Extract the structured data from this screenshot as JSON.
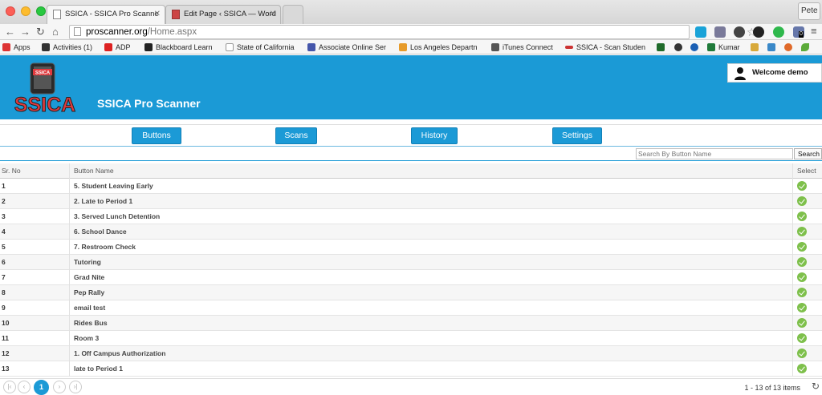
{
  "browser": {
    "tabs": [
      {
        "title": "SSICA - SSICA Pro Scanne",
        "active": true
      },
      {
        "title": "Edit Page ‹ SSICA — Word",
        "active": false
      }
    ],
    "user_name": "Pete",
    "url_host": "proscanner.org",
    "url_path": "/Home.aspx",
    "bookmarks": [
      "Apps",
      "Activities (1)",
      "ADP",
      "Blackboard Learn",
      "State of California",
      "Associate Online Ser",
      "Los Angeles Departn",
      "iTunes Connect",
      "SSICA - Scan Studen",
      "Kumar"
    ],
    "extension_badge": "0"
  },
  "app": {
    "logo_badge": "SSICA",
    "logo_text": "SSICA",
    "brand": "SSICA Pro Scanner",
    "welcome": "Welcome demo",
    "menu": [
      "Buttons",
      "Scans",
      "History",
      "Settings"
    ],
    "search_placeholder": "Search By Button Name",
    "search_button": "Search",
    "columns": {
      "sr": "Sr. No",
      "name": "Button Name",
      "select": "Select"
    },
    "rows": [
      {
        "sr": "1",
        "name": "5. Student Leaving Early"
      },
      {
        "sr": "2",
        "name": "2. Late to Period 1"
      },
      {
        "sr": "3",
        "name": "3. Served Lunch Detention"
      },
      {
        "sr": "4",
        "name": "6. School Dance"
      },
      {
        "sr": "5",
        "name": "7. Restroom Check"
      },
      {
        "sr": "6",
        "name": "Tutoring"
      },
      {
        "sr": "7",
        "name": "Grad Nite"
      },
      {
        "sr": "8",
        "name": "Pep Rally"
      },
      {
        "sr": "9",
        "name": "email test"
      },
      {
        "sr": "10",
        "name": "Rides Bus"
      },
      {
        "sr": "11",
        "name": "Room 3"
      },
      {
        "sr": "12",
        "name": "1. Off Campus Authorization"
      },
      {
        "sr": "13",
        "name": "late to Period 1"
      }
    ],
    "pager": {
      "current_page": "1",
      "info": "1 - 13 of 13 items"
    }
  },
  "colors": {
    "accent": "#1b9ad6",
    "check": "#7ec04b",
    "logo_red": "#e03a3e"
  }
}
